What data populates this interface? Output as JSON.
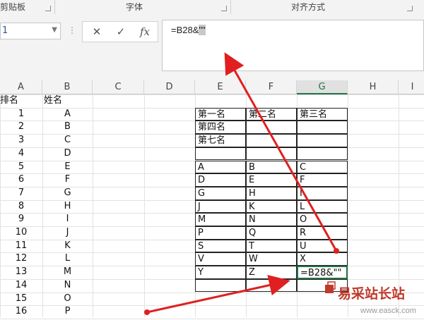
{
  "ribbon": {
    "groups": [
      "剪贴板",
      "字体",
      "对齐方式"
    ]
  },
  "name_box": {
    "value": "1"
  },
  "formula_buttons": {
    "cancel": "✕",
    "enter": "✓",
    "fx": "fx"
  },
  "formula_bar": {
    "prefix": "=B28&",
    "selected": "\"\""
  },
  "columns": [
    "A",
    "B",
    "C",
    "D",
    "E",
    "F",
    "G",
    "H",
    "I"
  ],
  "active_column": "G",
  "colA": [
    "排名",
    "1",
    "2",
    "3",
    "4",
    "5",
    "6",
    "7",
    "8",
    "9",
    "10",
    "11",
    "12",
    "13",
    "14",
    "15",
    "16"
  ],
  "colB": [
    "姓名",
    "A",
    "B",
    "C",
    "D",
    "E",
    "F",
    "G",
    "H",
    "I",
    "J",
    "K",
    "L",
    "M",
    "N",
    "O",
    "P"
  ],
  "table_top": [
    [
      "第一名",
      "第二名",
      "第三名"
    ],
    [
      "第四名",
      "",
      ""
    ],
    [
      "第七名",
      "",
      ""
    ]
  ],
  "table_bottom": [
    [
      "A",
      "B",
      "C"
    ],
    [
      "D",
      "E",
      "F"
    ],
    [
      "G",
      "H",
      "I"
    ],
    [
      "J",
      "K",
      "L"
    ],
    [
      "M",
      "N",
      "O"
    ],
    [
      "P",
      "Q",
      "R"
    ],
    [
      "S",
      "T",
      "U"
    ],
    [
      "V",
      "W",
      "X"
    ],
    [
      "Y",
      "Z",
      "=B28&\"\""
    ]
  ],
  "watermark": {
    "title": "易采站长站",
    "url": "www.easck.com"
  },
  "colors": {
    "accent": "#217346",
    "arrow": "#e02020",
    "ref": "#2f6ebd"
  }
}
